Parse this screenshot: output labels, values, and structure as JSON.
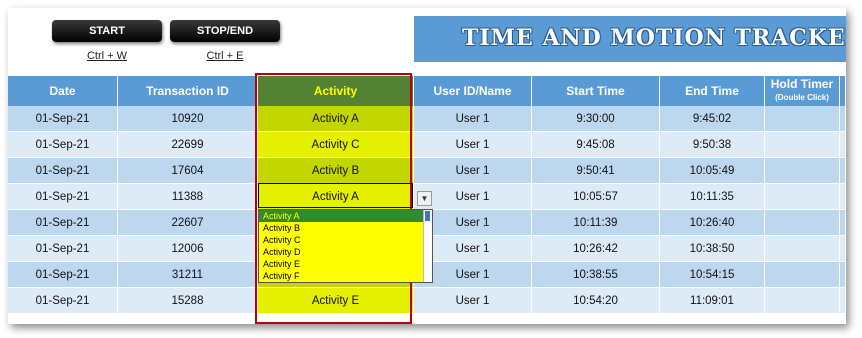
{
  "toolbar": {
    "start_label": "START",
    "start_shortcut": "Ctrl + W",
    "stop_label": "STOP/END",
    "stop_shortcut": "Ctrl + E"
  },
  "banner": {
    "title": "TIME AND MOTION TRACKER - PR"
  },
  "columns": {
    "date": "Date",
    "transaction_id": "Transaction ID",
    "activity": "Activity",
    "user": "User ID/Name",
    "start": "Start Time",
    "end": "End Time",
    "hold": "Hold Timer",
    "hold_hint": "(Double Click)"
  },
  "rows": [
    {
      "date": "01-Sep-21",
      "tid": "10920",
      "activity": "Activity A",
      "user": "User 1",
      "start": "9:30:00",
      "end": "9:45:02"
    },
    {
      "date": "01-Sep-21",
      "tid": "22699",
      "activity": "Activity C",
      "user": "User 1",
      "start": "9:45:08",
      "end": "9:50:38"
    },
    {
      "date": "01-Sep-21",
      "tid": "17604",
      "activity": "Activity B",
      "user": "User 1",
      "start": "9:50:41",
      "end": "10:05:49"
    },
    {
      "date": "01-Sep-21",
      "tid": "11388",
      "activity": "Activity A",
      "user": "User 1",
      "start": "10:05:57",
      "end": "10:11:35"
    },
    {
      "date": "01-Sep-21",
      "tid": "22607",
      "activity": "",
      "user": "User 1",
      "start": "10:11:39",
      "end": "10:26:40"
    },
    {
      "date": "01-Sep-21",
      "tid": "12006",
      "activity": "",
      "user": "User 1",
      "start": "10:26:42",
      "end": "10:38:50"
    },
    {
      "date": "01-Sep-21",
      "tid": "31211",
      "activity": "",
      "user": "User 1",
      "start": "10:38:55",
      "end": "10:54:15"
    },
    {
      "date": "01-Sep-21",
      "tid": "15288",
      "activity": "Activity E",
      "user": "User 1",
      "start": "10:54:20",
      "end": "11:09:01"
    }
  ],
  "dropdown": {
    "options": [
      "Activity A",
      "Activity B",
      "Activity C",
      "Activity D",
      "Activity E",
      "Activity F"
    ],
    "selected": "Activity A"
  }
}
